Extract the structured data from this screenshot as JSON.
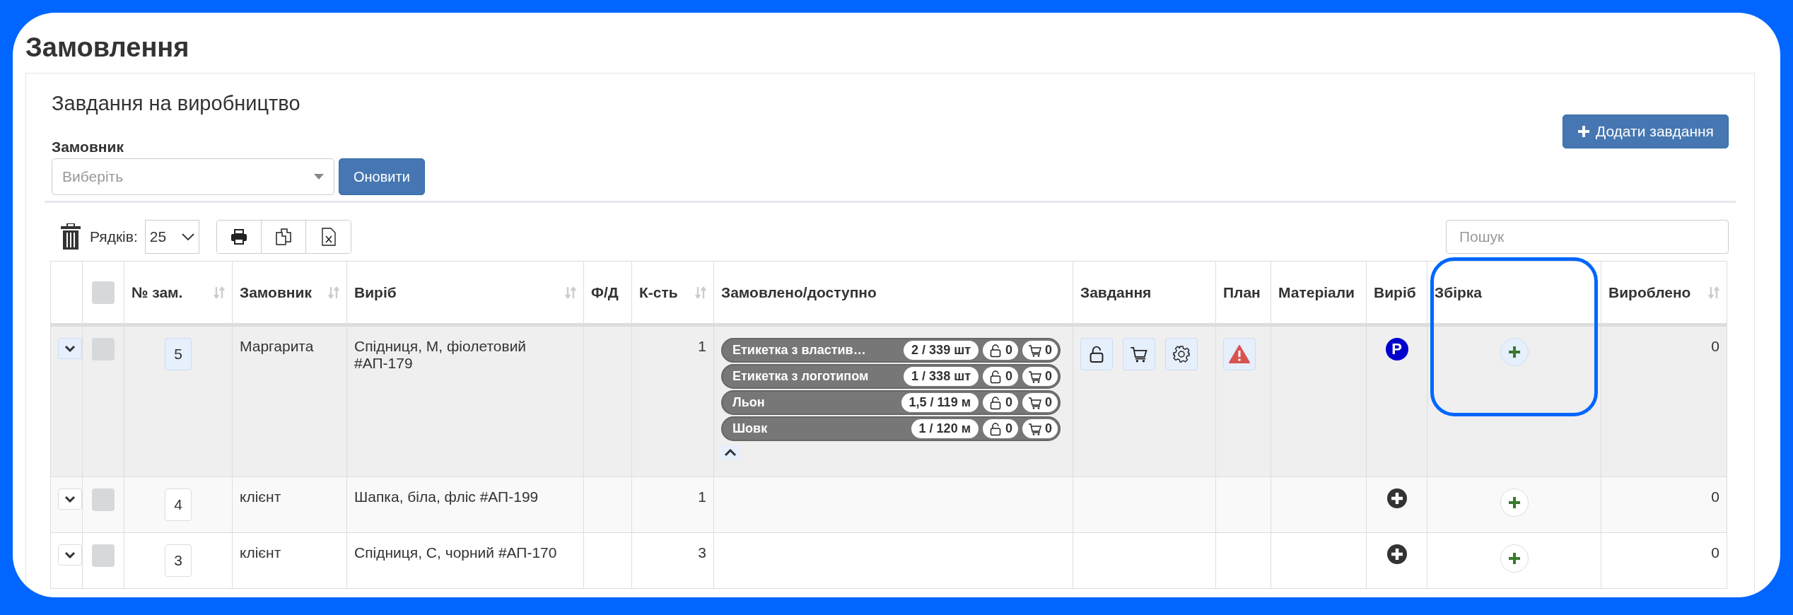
{
  "page": {
    "title": "Замовлення"
  },
  "panel": {
    "title": "Завдання на виробництво",
    "add_button": "Додати завдання"
  },
  "filter": {
    "label": "Замовник",
    "placeholder": "Виберіть",
    "refresh_button": "Оновити"
  },
  "toolbar": {
    "rows_label": "Рядків:",
    "rows_value": "25",
    "search_placeholder": "Пошук"
  },
  "table": {
    "header_checked": false,
    "columns": [
      {
        "kind": "expand"
      },
      {
        "kind": "check"
      },
      {
        "kind": "text",
        "label": "№ зам.",
        "sortable": true,
        "highlighted": false
      },
      {
        "kind": "text",
        "label": "Замовник",
        "sortable": true,
        "highlighted": false
      },
      {
        "kind": "text",
        "label": "Виріб",
        "sortable": true,
        "highlighted": false
      },
      {
        "kind": "text",
        "label": "Ф/Д",
        "sortable": false,
        "highlighted": false
      },
      {
        "kind": "text",
        "label": "К-сть",
        "sortable": true,
        "highlighted": false
      },
      {
        "kind": "text",
        "label": "Замовлено/доступно",
        "sortable": false,
        "highlighted": false
      },
      {
        "kind": "text",
        "label": "Завдання",
        "sortable": false,
        "highlighted": false
      },
      {
        "kind": "text",
        "label": "План",
        "sortable": false,
        "highlighted": false
      },
      {
        "kind": "text",
        "label": "Матеріали",
        "sortable": false,
        "highlighted": false
      },
      {
        "kind": "text",
        "label": "Виріб",
        "sortable": false,
        "highlighted": false
      },
      {
        "kind": "text",
        "label": "Збірка",
        "sortable": false,
        "highlighted": true
      },
      {
        "kind": "text",
        "label": "Вироблено",
        "sortable": true,
        "highlighted": false
      }
    ],
    "rows": [
      {
        "expanded": true,
        "checked": false,
        "number": "5",
        "customer": "Маргарита",
        "product": "Спідниця, М, фіолетовий #АП-179",
        "qty": "1",
        "materials": [
          {
            "name": "Етикетка з властив…",
            "amount": "2 / 339 шт",
            "reserved": "0",
            "ordered": "0"
          },
          {
            "name": "Етикетка з логотипом",
            "amount": "1 / 338 шт",
            "reserved": "0",
            "ordered": "0"
          },
          {
            "name": "Льон",
            "amount": "1,5 / 119 м",
            "reserved": "0",
            "ordered": "0"
          },
          {
            "name": "Шовк",
            "amount": "1 / 120 м",
            "reserved": "0",
            "ordered": "0"
          }
        ],
        "task_icons": [
          {
            "kind": "lock"
          },
          {
            "kind": "cart"
          },
          {
            "kind": "gear"
          }
        ],
        "plan_icons": [
          {
            "kind": "warning"
          }
        ],
        "product_badge": {
          "kind": "letter",
          "text": "P"
        },
        "produced": "0"
      },
      {
        "expanded": false,
        "checked": false,
        "number": "4",
        "customer": "клієнт",
        "product": "Шапка, біла, фліс #АП-199",
        "qty": "1",
        "product_badge": {
          "kind": "plus"
        },
        "produced": "0"
      },
      {
        "expanded": false,
        "checked": false,
        "number": "3",
        "customer": "клієнт",
        "product": "Спідниця, С, чорний #АП-170",
        "qty": "3",
        "product_badge": {
          "kind": "plus"
        },
        "produced": "0"
      }
    ]
  }
}
